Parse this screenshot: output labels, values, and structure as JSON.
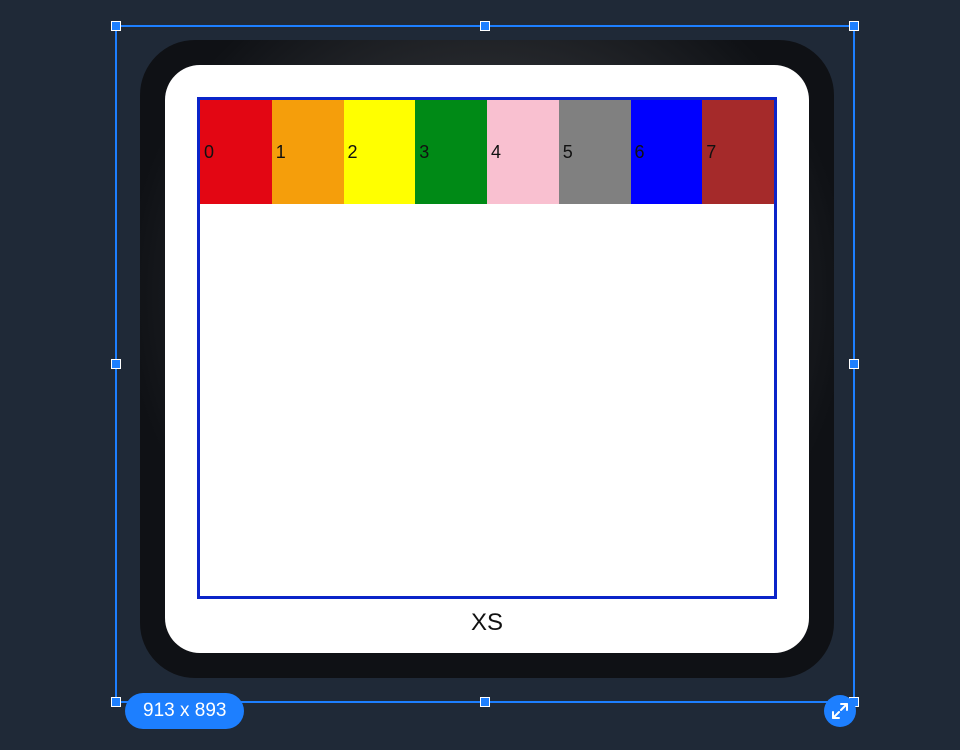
{
  "selection": {
    "size_label": "913 x 893"
  },
  "device": {
    "breakpoint_label": "XS"
  },
  "swatches": [
    {
      "label": "0",
      "color": "#e30613"
    },
    {
      "label": "1",
      "color": "#f59e0b"
    },
    {
      "label": "2",
      "color": "#ffff00"
    },
    {
      "label": "3",
      "color": "#008a16"
    },
    {
      "label": "4",
      "color": "#f9c0d0"
    },
    {
      "label": "5",
      "color": "#808080"
    },
    {
      "label": "6",
      "color": "#0000ff"
    },
    {
      "label": "7",
      "color": "#a52a2a"
    }
  ]
}
